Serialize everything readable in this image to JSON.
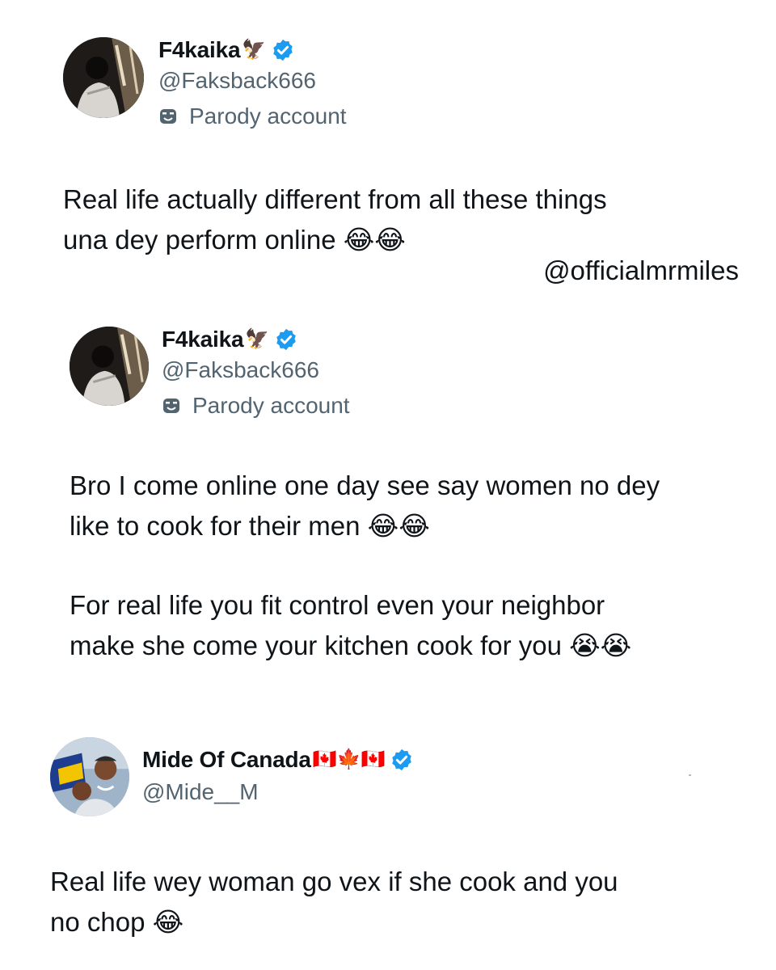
{
  "tweets": [
    {
      "display_name": "F4kaika",
      "name_emoji": "🦅",
      "handle": "@Faksback666",
      "label": "Parody account",
      "lines": [
        "Real life actually different from all these things",
        "una dey perform online 😂😂"
      ],
      "label_icon": "parody-mask-icon"
    },
    {
      "display_name": "F4kaika",
      "name_emoji": "🦅",
      "handle": "@Faksback666",
      "label": "Parody account",
      "lines": [
        "Bro I come online one day see say women no dey",
        "like to cook for their men 😂😂",
        "For real life you fit control even your neighbor",
        "make she come your kitchen cook for you 😭😭"
      ],
      "label_icon": "parody-mask-icon"
    },
    {
      "display_name": "Mide Of Canada",
      "name_emoji": "🇨🇦🍁🇨🇦",
      "handle": "@Mide__M",
      "lines": [
        "Real life wey woman go vex if she cook and you",
        "no chop 😂"
      ]
    }
  ],
  "watermark": "@officialmrmiles",
  "colors": {
    "verified": "#1d9bf0",
    "secondary_text": "#536471",
    "text": "#0f1419"
  }
}
